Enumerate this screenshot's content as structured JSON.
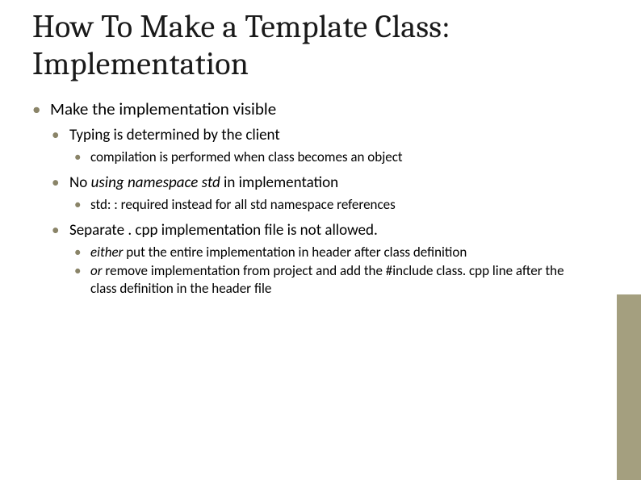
{
  "title": "How To Make a Template Class: Implementation",
  "bullets": {
    "l1_1": "Make the implementation visible",
    "l2_1": "Typing is determined by the client",
    "l3_1": "compilation is performed when class becomes an object",
    "l2_2_pre": "No ",
    "l2_2_it": "using namespace std",
    "l2_2_post": " in implementation",
    "l3_2": "std: : required instead for all std namespace references",
    "l2_3": "Separate . cpp implementation file is not allowed.",
    "l3_3_it": "either",
    "l3_3_post": " put the entire implementation in header after class definition",
    "l3_4_it": "or",
    "l3_4_post": " remove implementation from project and add the #include class. cpp line after the class definition in the header file"
  }
}
